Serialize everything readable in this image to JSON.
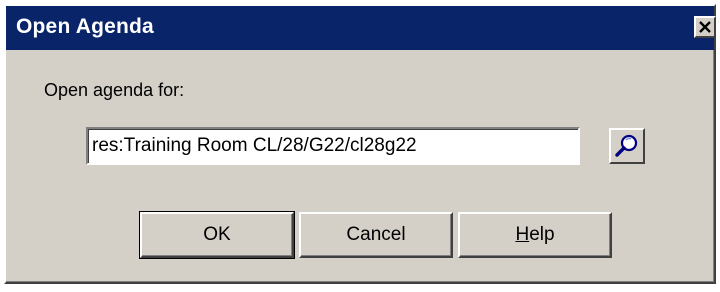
{
  "window": {
    "title": "Open Agenda",
    "close_glyph": "✕"
  },
  "form": {
    "prompt_label": "Open agenda for:",
    "agenda_value": "res:Training Room CL/28/G22/cl28g22",
    "browse_icon": "magnifier-icon"
  },
  "buttons": {
    "ok_label": "OK",
    "cancel_label": "Cancel",
    "help_mnemonic": "H",
    "help_rest": "elp"
  },
  "colors": {
    "titlebar": "#0a246a",
    "face": "#d4d0c8"
  }
}
